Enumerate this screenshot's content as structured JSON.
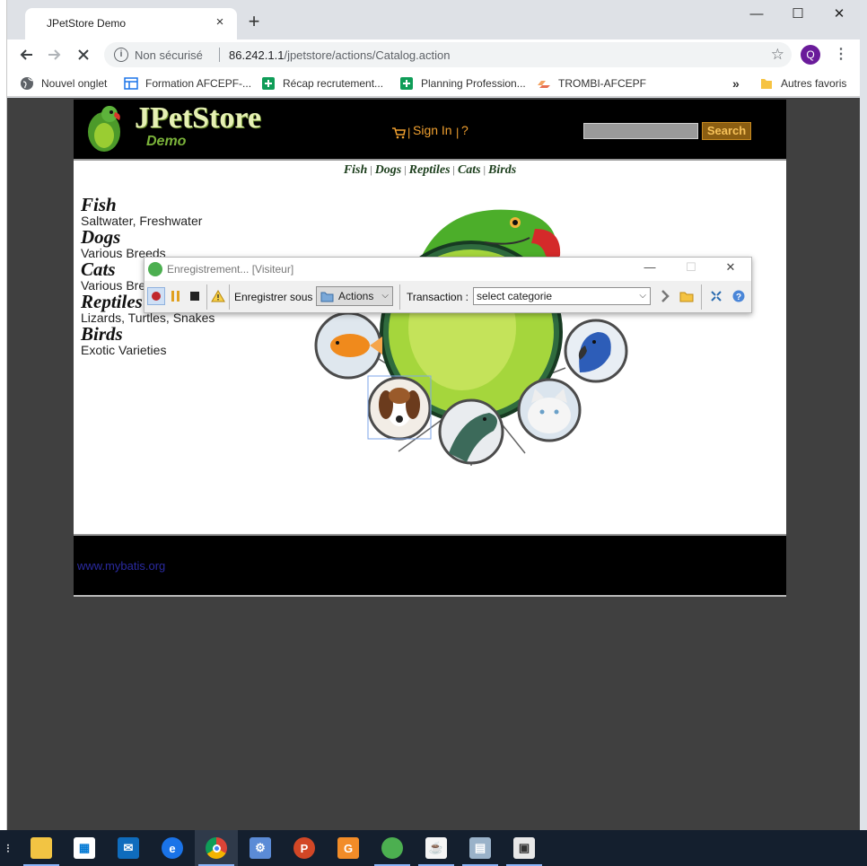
{
  "browser": {
    "tab_title": "JPetStore Demo",
    "tab_close": "×",
    "new_tab": "+",
    "window_controls": {
      "minimize": "—",
      "maximize": "☐",
      "close": "✕"
    },
    "security_label": "Non sécurisé",
    "url_host": "86.242.1.1",
    "url_path": "/jpetstore/actions/Catalog.action",
    "profile_initial": "Q",
    "bookmarks": [
      {
        "label": "Nouvel onglet",
        "icon": "globe-icon"
      },
      {
        "label": "Formation AFCEPF-...",
        "icon": "doc-icon"
      },
      {
        "label": "Récap recrutement...",
        "icon": "sheets-icon"
      },
      {
        "label": "Planning Profession...",
        "icon": "sheets-icon"
      },
      {
        "label": "TROMBI-AFCEPF",
        "icon": "drive-icon"
      }
    ],
    "bookmarks_more": "»",
    "other_bookmarks": "Autres favoris"
  },
  "store": {
    "logo_title": "JPetStore",
    "logo_subtitle": "Demo",
    "sign_in": "Sign In",
    "help": "?",
    "search_button": "Search",
    "search_value": "",
    "quicklinks": [
      "Fish",
      "Dogs",
      "Reptiles",
      "Cats",
      "Birds"
    ],
    "categories": [
      {
        "name": "Fish",
        "description": "Saltwater, Freshwater"
      },
      {
        "name": "Dogs",
        "description": "Various Breeds"
      },
      {
        "name": "Cats",
        "description": "Various Breeds"
      },
      {
        "name": "Reptiles",
        "description": "Lizards, Turtles, Snakes"
      },
      {
        "name": "Birds",
        "description": "Exotic Varieties"
      }
    ],
    "footer_link": "www.mybatis.org"
  },
  "recorder": {
    "title": "Enregistrement... [Visiteur]",
    "save_as_label": "Enregistrer sous :",
    "actions_label": "Actions",
    "transaction_label": "Transaction :",
    "transaction_value": "select categorie"
  },
  "colors": {
    "store_orange": "#f0a030",
    "parrot_green": "#7bb33a",
    "taskbar": "#141f2e"
  },
  "taskbar": {
    "apps": [
      "file-explorer-icon",
      "store-icon",
      "mail-icon",
      "edge-icon",
      "chrome-icon",
      "control-panel-icon",
      "powerpoint-icon",
      "gatling-icon",
      "neoload-icon",
      "java-icon",
      "monitor-icon",
      "media-icon"
    ]
  }
}
